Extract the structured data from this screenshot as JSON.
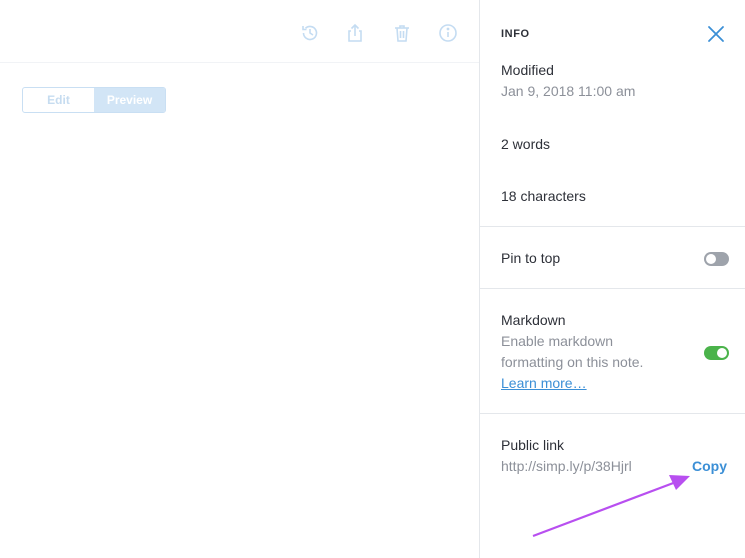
{
  "editor": {
    "toolbar": {
      "icons": [
        "history-icon",
        "share-icon",
        "trash-icon",
        "info-icon"
      ]
    },
    "mode_toggle": {
      "edit_label": "Edit",
      "preview_label": "Preview",
      "selected": "Preview"
    }
  },
  "info_panel": {
    "title": "INFO",
    "modified_label": "Modified",
    "modified_value": "Jan 9, 2018 11:00 am",
    "words": "2 words",
    "characters": "18 characters",
    "pin": {
      "label": "Pin to top",
      "enabled": false
    },
    "markdown": {
      "label": "Markdown",
      "description_line1": "Enable markdown",
      "description_line2": "formatting on this note.",
      "learn_more": "Learn more…",
      "enabled": true
    },
    "public_link": {
      "label": "Public link",
      "url": "http://simp.ly/p/38Hjrl",
      "copy_label": "Copy"
    }
  },
  "colors": {
    "accent": "#3b8fd6",
    "toggle_on": "#4bb34b",
    "toggle_off": "#9ea3ab",
    "annotation_arrow": "#b84ff0"
  }
}
